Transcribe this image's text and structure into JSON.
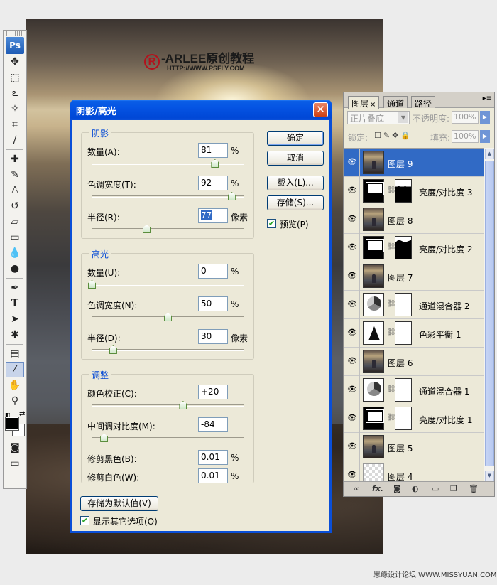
{
  "canvas": {
    "logo_symbol": "R",
    "logo_text": "-ARLEE原创教程",
    "logo_url": "HTTP://WWW.PSFLY.COM"
  },
  "toolbox": {
    "app_label": "Ps",
    "tools": [
      "move-icon",
      "marquee-icon",
      "lasso-icon",
      "magic-wand-icon",
      "crop-icon",
      "slice-icon",
      "healing-brush-icon",
      "brush-icon",
      "clone-stamp-icon",
      "history-brush-icon",
      "eraser-icon",
      "gradient-icon",
      "blur-icon",
      "dodge-icon",
      "pen-icon",
      "type-icon",
      "path-selection-icon",
      "custom-shape-icon",
      "notes-icon",
      "eyedropper-icon",
      "hand-icon",
      "zoom-icon"
    ],
    "active_tool": "eyedropper-icon"
  },
  "dialog": {
    "title": "阴影/高光",
    "shadows": {
      "title": "阴影",
      "amount": {
        "label": "数量(A):",
        "value": "81",
        "unit": "%",
        "slider": 0.81
      },
      "tonal_width": {
        "label": "色调宽度(T):",
        "value": "92",
        "unit": "%",
        "slider": 0.92
      },
      "radius": {
        "label": "半径(R):",
        "value": "77",
        "unit": "像素",
        "slider": 0.36
      }
    },
    "highlights": {
      "title": "高光",
      "amount": {
        "label": "数量(U):",
        "value": "0",
        "unit": "%",
        "slider": 0.0
      },
      "tonal_width": {
        "label": "色调宽度(N):",
        "value": "50",
        "unit": "%",
        "slider": 0.5
      },
      "radius": {
        "label": "半径(D):",
        "value": "30",
        "unit": "像素",
        "slider": 0.14
      }
    },
    "adjustments": {
      "title": "调整",
      "color_correction": {
        "label": "颜色校正(C):",
        "value": "+20",
        "slider": 0.6
      },
      "midtone_contrast": {
        "label": "中间调对比度(M):",
        "value": "-84",
        "slider": 0.08
      },
      "black_clip": {
        "label": "修剪黑色(B):",
        "value": "0.01",
        "unit": "%"
      },
      "white_clip": {
        "label": "修剪白色(W):",
        "value": "0.01",
        "unit": "%"
      }
    },
    "buttons": {
      "ok": "确定",
      "cancel": "取消",
      "load": "载入(L)...",
      "save": "存储(S)...",
      "save_defaults": "存储为默认值(V)"
    },
    "preview_label": "预览(P)",
    "preview_checked": true,
    "show_more_label": "显示其它选项(O)",
    "show_more_checked": true
  },
  "layers_panel": {
    "tabs": [
      {
        "label": "图层",
        "active": true,
        "closable": "×"
      },
      {
        "label": "通道",
        "active": false
      },
      {
        "label": "路径",
        "active": false
      }
    ],
    "menu_glyph": "▸≡",
    "blend_mode": "正片叠底",
    "opacity_label": "不透明度:",
    "opacity_value": "100%",
    "lock_label": "锁定:",
    "fill_label": "填充:",
    "fill_value": "100%",
    "layers": [
      {
        "name": "图层 9",
        "thumb": "image",
        "selected": true,
        "mask": ""
      },
      {
        "name": "亮度/对比度 3",
        "thumb": "adjust-dark",
        "selected": false,
        "mask": "m1"
      },
      {
        "name": "图层 8",
        "thumb": "image",
        "selected": false,
        "mask": ""
      },
      {
        "name": "亮度/对比度 2",
        "thumb": "adjust-dark",
        "selected": false,
        "mask": "m2"
      },
      {
        "name": "图层 7",
        "thumb": "image",
        "selected": false,
        "mask": ""
      },
      {
        "name": "通道混合器 2",
        "thumb": "adjust-mix",
        "selected": false,
        "mask": "white"
      },
      {
        "name": "色彩平衡 1",
        "thumb": "adjust-bal",
        "selected": false,
        "mask": "white"
      },
      {
        "name": "图层 6",
        "thumb": "image",
        "selected": false,
        "mask": ""
      },
      {
        "name": "通道混合器 1",
        "thumb": "adjust-mix",
        "selected": false,
        "mask": "white"
      },
      {
        "name": "亮度/对比度 1",
        "thumb": "adjust-dark",
        "selected": false,
        "mask": "white"
      },
      {
        "name": "图层 5",
        "thumb": "image",
        "selected": false,
        "mask": ""
      },
      {
        "name": "图层 4",
        "thumb": "checker",
        "selected": false,
        "mask": ""
      }
    ],
    "bottom_fx": "fx."
  },
  "watermark": "思缘设计论坛 WWW.MISSYUAN.COM"
}
